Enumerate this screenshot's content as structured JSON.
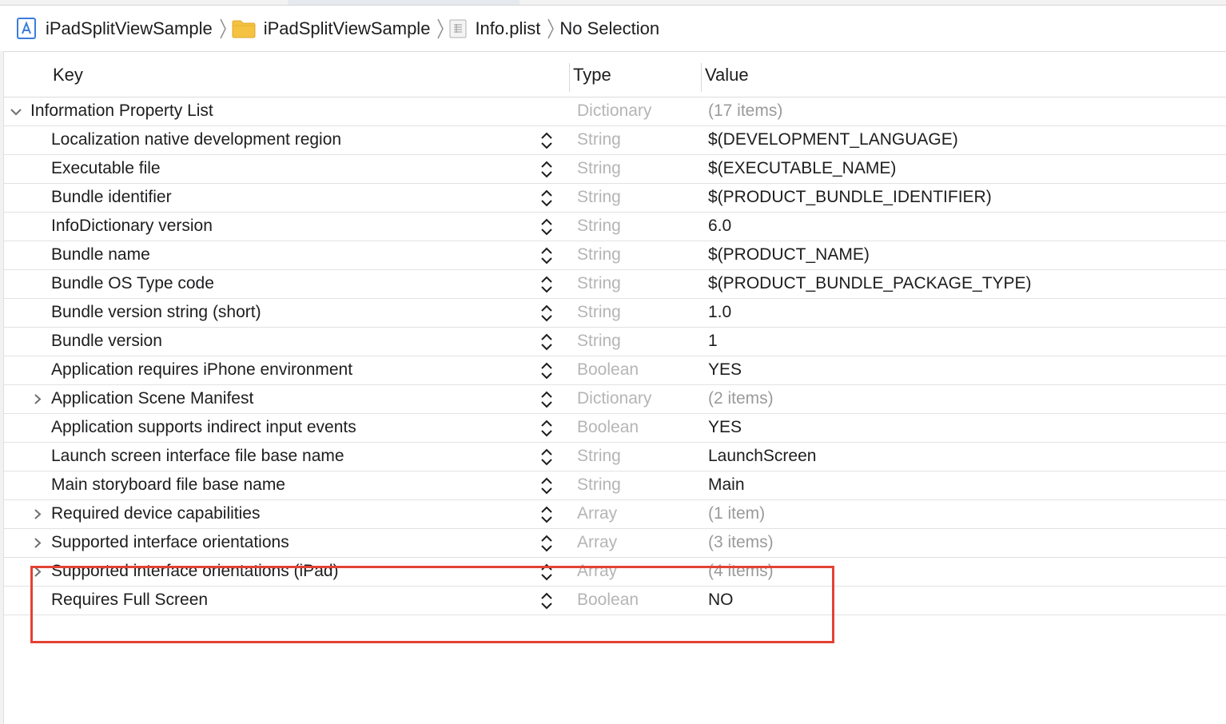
{
  "breadcrumb": {
    "project": "iPadSplitViewSample",
    "group": "iPadSplitViewSample",
    "file": "Info.plist",
    "selection": "No Selection",
    "project_icon": "xcode-project-icon",
    "group_icon": "folder-icon",
    "file_icon": "plist-file-icon"
  },
  "table": {
    "headers": {
      "key": "Key",
      "type": "Type",
      "value": "Value"
    },
    "root": {
      "key": "Information Property List",
      "type": "Dictionary",
      "value": "(17 items)"
    },
    "rows": [
      {
        "key": "Localization native development region",
        "type": "String",
        "value": "$(DEVELOPMENT_LANGUAGE)"
      },
      {
        "key": "Executable file",
        "type": "String",
        "value": "$(EXECUTABLE_NAME)"
      },
      {
        "key": "Bundle identifier",
        "type": "String",
        "value": "$(PRODUCT_BUNDLE_IDENTIFIER)"
      },
      {
        "key": "InfoDictionary version",
        "type": "String",
        "value": "6.0"
      },
      {
        "key": "Bundle name",
        "type": "String",
        "value": "$(PRODUCT_NAME)"
      },
      {
        "key": "Bundle OS Type code",
        "type": "String",
        "value": "$(PRODUCT_BUNDLE_PACKAGE_TYPE)"
      },
      {
        "key": "Bundle version string (short)",
        "type": "String",
        "value": "1.0"
      },
      {
        "key": "Bundle version",
        "type": "String",
        "value": "1"
      },
      {
        "key": "Application requires iPhone environment",
        "type": "Boolean",
        "value": "YES"
      },
      {
        "key": "Application Scene Manifest",
        "type": "Dictionary",
        "value": "(2 items)"
      },
      {
        "key": "Application supports indirect input events",
        "type": "Boolean",
        "value": "YES"
      },
      {
        "key": "Launch screen interface file base name",
        "type": "String",
        "value": "LaunchScreen"
      },
      {
        "key": "Main storyboard file base name",
        "type": "String",
        "value": "Main"
      },
      {
        "key": "Required device capabilities",
        "type": "Array",
        "value": "(1 item)"
      },
      {
        "key": "Supported interface orientations",
        "type": "Array",
        "value": "(3 items)"
      },
      {
        "key": "Supported interface orientations (iPad)",
        "type": "Array",
        "value": "(4 items)"
      },
      {
        "key": "Requires Full Screen",
        "type": "Boolean",
        "value": "NO"
      }
    ]
  },
  "annotation": {
    "color": "#e34234"
  }
}
